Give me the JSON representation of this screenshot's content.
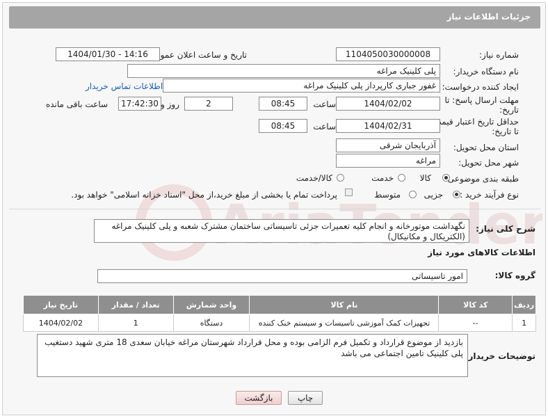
{
  "header": {
    "title": "جزئیات اطلاعات نیاز"
  },
  "form": {
    "need_number_label": "شماره نیاز:",
    "need_number": "1104050030000008",
    "announce_label": "تاریخ و ساعت اعلان عمومی:",
    "announce_value": "1404/01/30 - 14:16",
    "buyer_org_label": "نام دستگاه خریدار:",
    "buyer_org": "پلی کلینیک مراغه",
    "creator_label": "ایجاد کننده درخواست:",
    "creator": "غفور جباری کارپرداز پلی کلینیک مراغه",
    "contact_link": "اطلاعات تماس خریدار",
    "reply_deadline_label_1": "مهلت ارسال پاسخ: تا",
    "reply_deadline_label_2": "تاریخ:",
    "reply_date": "1404/02/02",
    "time_label": "ساعت",
    "reply_time": "08:45",
    "days_value": "2",
    "days_label": "روز و",
    "remaining_time": "17:42:30",
    "remaining_label": "ساعت باقی مانده",
    "price_validity_label_1": "حداقل تاریخ اعتبار قیمت:",
    "price_validity_label_2": "تا تاریخ:",
    "price_date": "1404/02/31",
    "price_time": "08:45",
    "province_label": "استان محل تحویل:",
    "province": "آذربایجان شرقی",
    "city_label": "شهر محل تحویل:",
    "city": "مراغه",
    "category_label": "طبقه بندی موضوعی:",
    "category_options": [
      "کالا",
      "خدمت",
      "کالا/خدمت"
    ],
    "process_label": "نوع فرآیند خرید :",
    "process_options": [
      "جزیی",
      "متوسط"
    ],
    "payment_note": "پرداخت تمام یا بخشی از مبلغ خرید،از محل \"اسناد خزانه اسلامی\" خواهد بود."
  },
  "description": {
    "label": "شرح کلی نیاز:",
    "text": "نگهداشت موتورخانه و انجام کلیه تعمیرات جزئی تاسیساتی ساختمان مشترک  شعبه و پلی کلینیک  مراغه (الکتریکال و مکانیکال)"
  },
  "goods": {
    "section_title": "اطلاعات کالاهای مورد نیاز",
    "group_label": "گروه کالا:",
    "group_value": "امور تاسیساتی",
    "columns": [
      "ردیف",
      "کد کالا",
      "نام کالا",
      "واحد شمارش",
      "تعداد / مقدار",
      "تاریخ نیاز"
    ],
    "rows": [
      [
        "1",
        "--",
        "تجهیزات کمک آموزشی تاسیسات و سیستم خنک کننده",
        "دستگاه",
        "1",
        "1404/02/02"
      ]
    ]
  },
  "notes": {
    "label": "توضیحات خریدار:",
    "text": "بازدید از موضوع قرارداد و تکمیل فرم الزامی بوده و محل قرارداد شهرستان مراغه خیابان سعدی 18 متری شهید دستغیب پلی کلینیک تامین اجتماعی می باشد"
  },
  "buttons": {
    "print": "چاپ",
    "back": "بازگشت"
  },
  "colors": {
    "header_bg": "#a5a5a5",
    "table_header_bg": "#8f8f8f",
    "link": "#1a5fb4",
    "watermark": "#e4b9b9"
  }
}
